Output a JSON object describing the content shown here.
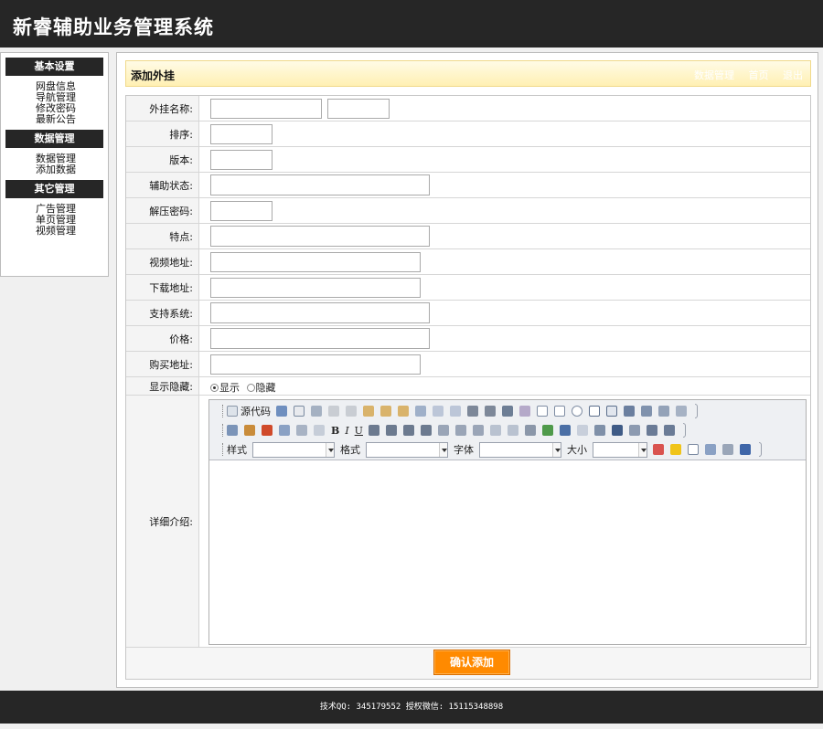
{
  "app": {
    "title": "新睿辅助业务管理系统"
  },
  "sidebar": {
    "sections": [
      {
        "title": "基本设置",
        "items": [
          "网盘信息",
          "导航管理",
          "修改密码",
          "最新公告"
        ]
      },
      {
        "title": "数据管理",
        "items": [
          "数据管理",
          "添加数据"
        ]
      },
      {
        "title": "其它管理",
        "items": [
          "广告管理",
          "单页管理",
          "视频管理"
        ]
      }
    ]
  },
  "panel": {
    "title": "添加外挂",
    "links": [
      "数据管理",
      "首页",
      "退出"
    ]
  },
  "form": {
    "labels": {
      "name": "外挂名称:",
      "order": "排序:",
      "version": "版本:",
      "status": "辅助状态:",
      "unzip_password": "解压密码:",
      "features": "特点:",
      "video_url": "视频地址:",
      "download_url": "下载地址:",
      "systems": "支持系统:",
      "price": "价格:",
      "buy_url": "购买地址:",
      "visibility": "显示隐藏:",
      "detail": "详细介绍:"
    },
    "visibility_options": {
      "show": "显示",
      "hide": "隐藏",
      "selected": "show"
    },
    "submit_label": "确认添加"
  },
  "editor": {
    "source_label": "源代码",
    "style_label": "样式",
    "format_label": "格式",
    "font_label": "字体",
    "size_label": "大小"
  },
  "footer": {
    "text": "技术QQ: 345179552 授权微信: 15115348898"
  }
}
